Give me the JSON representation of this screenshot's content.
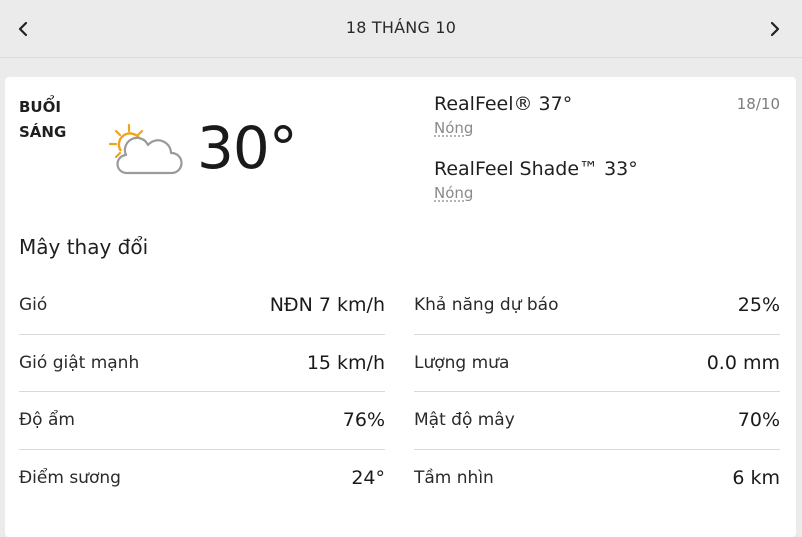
{
  "header": {
    "title": "18 THÁNG 10",
    "prev_icon": "chevron-left-icon",
    "next_icon": "chevron-right-icon"
  },
  "card": {
    "period": [
      "BUỔI",
      "SÁNG"
    ],
    "icon": "partly-sunny-icon",
    "temperature": "30°",
    "date": "18/10",
    "realfeel": {
      "title": "RealFeel® 37°",
      "desc": "Nóng"
    },
    "realfeel_shade": {
      "title": "RealFeel Shade™ 33°",
      "desc": "Nóng"
    },
    "phrase": "Mây thay đổi",
    "left_details": [
      {
        "label": "Gió",
        "value": "NĐN 7 km/h"
      },
      {
        "label": "Gió giật mạnh",
        "value": "15 km/h"
      },
      {
        "label": "Độ ẩm",
        "value": "76%"
      },
      {
        "label": "Điểm sương",
        "value": "24°"
      }
    ],
    "right_details": [
      {
        "label": "Khả năng dự báo",
        "value": "25%"
      },
      {
        "label": "Lượng mưa",
        "value": "0.0 mm"
      },
      {
        "label": "Mật độ mây",
        "value": "70%"
      },
      {
        "label": "Tầm nhìn",
        "value": "6 km"
      }
    ],
    "colors": {
      "sun": "#f0a31d",
      "cloud_stroke": "#9a9a9a"
    }
  }
}
